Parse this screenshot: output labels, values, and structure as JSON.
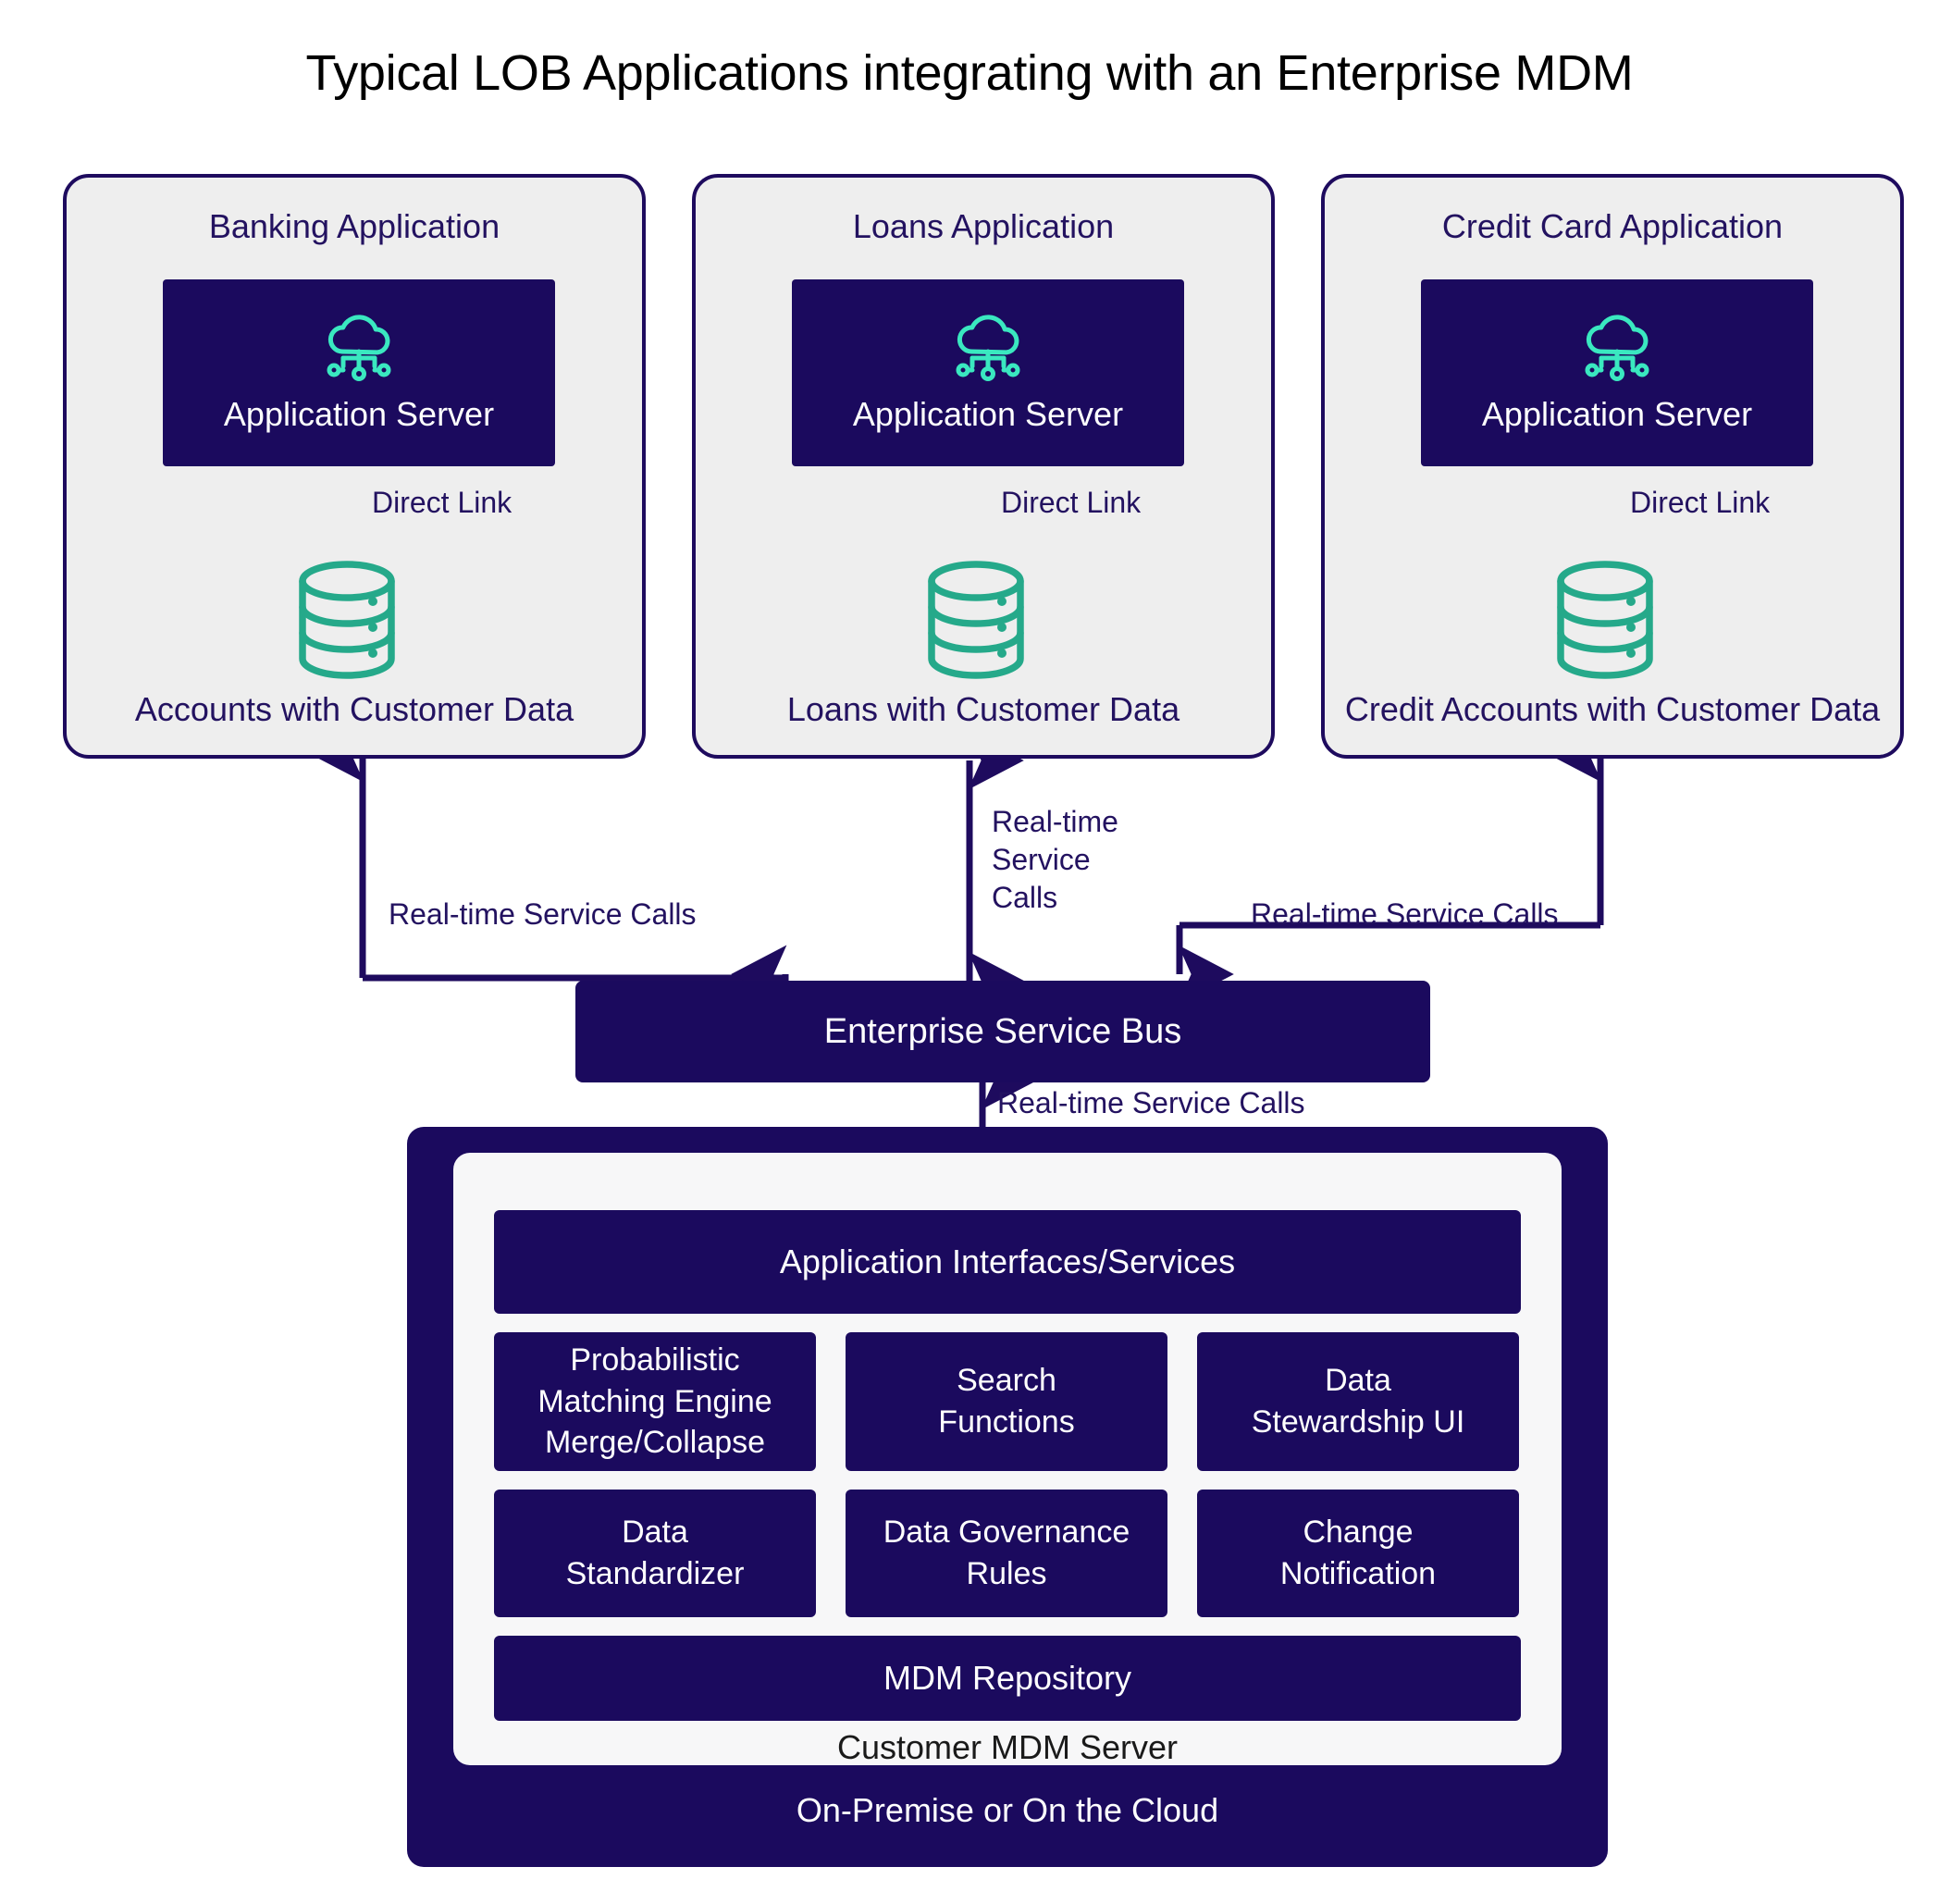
{
  "title": "Typical LOB Applications integrating with an Enterprise MDM",
  "colors": {
    "navy": "#1b0a5e",
    "panel_gray": "#eeeeee",
    "teal_cloud": "#3ae8c0",
    "teal_db": "#25a98a",
    "text_navy": "#231260",
    "white": "#ffffff",
    "mdm_inner": "#f7f7f8"
  },
  "applications": [
    {
      "title": "Banking Application",
      "server_label": "Application Server",
      "server_icon": "cloud-network-icon",
      "link_label": "Direct Link",
      "db_icon": "database-cylinder-icon",
      "caption": "Accounts with Customer Data",
      "connector_label": "Real-time Service Calls"
    },
    {
      "title": "Loans Application",
      "server_label": "Application Server",
      "server_icon": "cloud-network-icon",
      "link_label": "Direct Link",
      "db_icon": "database-cylinder-icon",
      "caption": "Loans with Customer Data",
      "connector_label": "Real-time\nService\nCalls"
    },
    {
      "title": "Credit Card Application",
      "server_label": "Application Server",
      "server_icon": "cloud-network-icon",
      "link_label": "Direct Link",
      "db_icon": "database-cylinder-icon",
      "caption": "Credit Accounts with Customer Data",
      "connector_label": "Real-time Service Calls"
    }
  ],
  "esb": {
    "label": "Enterprise Service Bus",
    "downlink_label": "Real-time Service Calls"
  },
  "mdm": {
    "cloud_label": "On-Premise or On the Cloud",
    "server_label": "Customer MDM Server",
    "interfaces_label": "Application Interfaces/Services",
    "repository_label": "MDM Repository",
    "cells": [
      "Probabilistic\nMatching Engine\nMerge/Collapse",
      "Search\nFunctions",
      "Data\nStewardship UI",
      "Data\nStandardizer",
      "Data Governance\nRules",
      "Change\nNotification"
    ]
  }
}
